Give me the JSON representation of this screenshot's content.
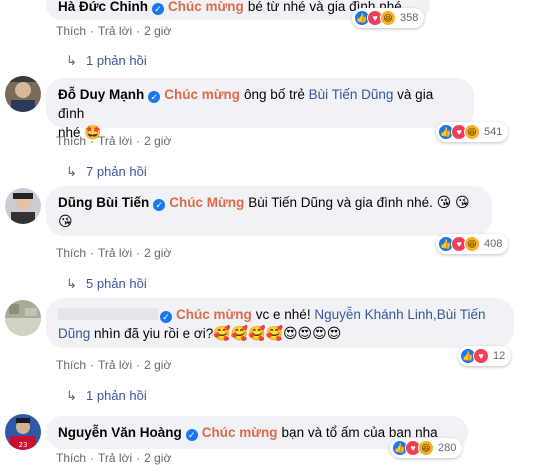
{
  "comments": [
    {
      "author": "Hà Đức Chinh",
      "tag": "Chúc mừng",
      "text": "bé từ nhé và gia đình nhé",
      "react_count": "358",
      "actions": {
        "like": "Thích",
        "reply": "Trả lời",
        "time": "2 giờ"
      },
      "replies": "1 phản hồi"
    },
    {
      "author": "Đỗ Duy Mạnh",
      "tag": "Chúc mừng",
      "text_before": "ông bố trẻ",
      "mention": "Bùi Tiến Dũng",
      "text_after": "và gia đình",
      "text_line2": "nhé",
      "react_count": "541",
      "actions": {
        "like": "Thích",
        "reply": "Trả lời",
        "time": "2 giờ"
      },
      "replies": "7 phản hồi"
    },
    {
      "author": "Dũng Bùi Tiến",
      "tag": "Chúc Mừng",
      "text": "Bùi Tiến Dũng và gia đình nhé.",
      "react_count": "408",
      "actions": {
        "like": "Thích",
        "reply": "Trả lời",
        "time": "2 giờ"
      },
      "replies": "5 phản hồi"
    },
    {
      "author": "",
      "tag": "Chúc mừng",
      "text_before": "vc e nhé!",
      "mention": "Nguyễn Khánh Linh,Bùi Tiến",
      "mention2": "Dũng",
      "text_after": "nhìn đã yiu rồi e ơi?",
      "react_count": "12",
      "actions": {
        "like": "Thích",
        "reply": "Trả lời",
        "time": "2 giờ"
      },
      "replies": "1 phản hồi"
    },
    {
      "author": "Nguyễn Văn Hoàng",
      "tag": "Chúc mừng",
      "text": "bạn và tổ ấm của bạn nha",
      "react_count": "280",
      "actions": {
        "like": "Thích",
        "reply": "Trả lời",
        "time": "2 giờ"
      }
    }
  ],
  "colors": {
    "tag": "#e06a4c",
    "link": "#385898",
    "bubble": "#f0f2f5",
    "verified": "#1877f2"
  },
  "icons": {
    "verified": "check-badge-icon",
    "reply_arrow": "reply-arrow-icon",
    "like": "like-reaction-icon",
    "love": "love-reaction-icon",
    "haha": "haha-reaction-icon"
  }
}
